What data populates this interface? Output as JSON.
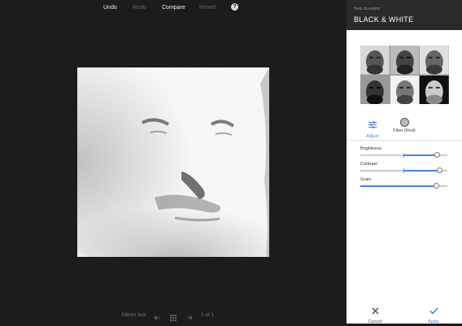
{
  "toolbar": {
    "undo_label": "Undo",
    "redo_label": "Redo",
    "compare_label": "Compare",
    "revert_label": "Revert",
    "help_label": "?"
  },
  "bottom": {
    "album_label": "Album test",
    "page_indicator": "1 of 1"
  },
  "panel": {
    "preset_subtitle": "THE CLASSIC",
    "preset_title": "BLACK & WHITE",
    "tabs": [
      {
        "label": "Adjust",
        "icon": "sliders-icon",
        "active": true
      },
      {
        "label": "Filter (Red)",
        "icon": "color-circle-icon",
        "active": false
      }
    ],
    "sliders": [
      {
        "label": "Brightness",
        "value": 0.88
      },
      {
        "label": "Contrast",
        "value": 0.91
      },
      {
        "label": "Grain",
        "value": 0.87
      }
    ],
    "cancel_label": "Cancel",
    "apply_label": "Apply"
  },
  "colors": {
    "background": "#1c1c1c",
    "accent": "#4285f4",
    "panel_header": "#2a2a2a"
  }
}
